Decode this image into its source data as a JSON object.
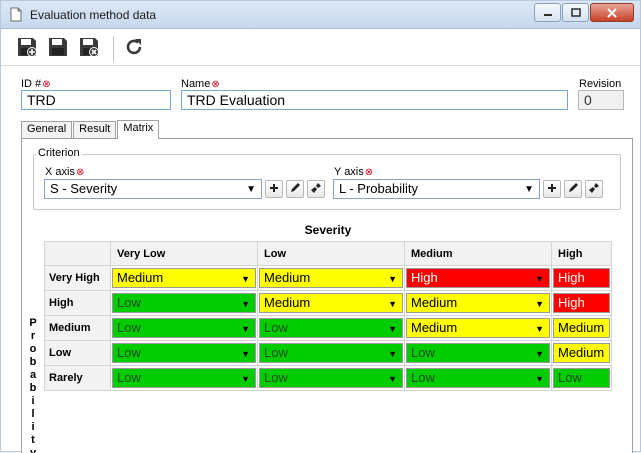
{
  "window": {
    "title": "Evaluation method data"
  },
  "toolbar": {
    "buttons": [
      {
        "name": "save-new-icon"
      },
      {
        "name": "save-icon"
      },
      {
        "name": "save-close-icon"
      },
      {
        "name": "refresh-icon"
      }
    ]
  },
  "form": {
    "id_label": "ID #",
    "id_value": "TRD",
    "name_label": "Name",
    "name_value": "TRD Evaluation",
    "revision_label": "Revision",
    "revision_value": "0"
  },
  "tabs": [
    {
      "label": "General"
    },
    {
      "label": "Result"
    },
    {
      "label": "Matrix",
      "active": true
    }
  ],
  "criterion": {
    "legend": "Criterion",
    "x_axis_label": "X axis",
    "x_axis_value": "S - Severity",
    "y_axis_label": "Y axis",
    "y_axis_value": "L - Probability"
  },
  "matrix": {
    "title": "Severity",
    "row_axis_label": "Probability",
    "columns": [
      "Very Low",
      "Low",
      "Medium",
      "High"
    ],
    "rows": [
      {
        "label": "Very High",
        "cells": [
          "Medium",
          "Medium",
          "High",
          "High"
        ]
      },
      {
        "label": "High",
        "cells": [
          "Low",
          "Medium",
          "Medium",
          "High"
        ]
      },
      {
        "label": "Medium",
        "cells": [
          "Low",
          "Low",
          "Medium",
          "Medium"
        ]
      },
      {
        "label": "Low",
        "cells": [
          "Low",
          "Low",
          "Low",
          "Medium"
        ]
      },
      {
        "label": "Rarely",
        "cells": [
          "Low",
          "Low",
          "Low",
          "Low"
        ]
      }
    ],
    "colors": {
      "Low": "#00cc00",
      "Medium": "#ffff00",
      "High": "#ff0000"
    },
    "text_colors": {
      "Low": "#1a4d1a",
      "Medium": "#000000",
      "High": "#ffffff"
    }
  }
}
